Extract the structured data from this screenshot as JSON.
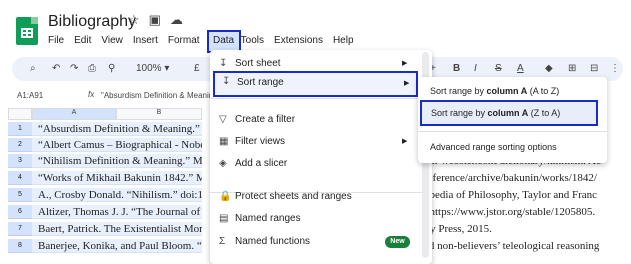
{
  "app": {
    "title": "Bibliography"
  },
  "menubar": [
    "File",
    "Edit",
    "View",
    "Insert",
    "Format",
    "Data",
    "Tools",
    "Extensions",
    "Help"
  ],
  "toolbar": {
    "zoom": "100%",
    "zoom_caret": "▾",
    "font_size_partial": "£",
    "bold": "B",
    "italic": "I",
    "strike": "S",
    "text_color": "A"
  },
  "formula_bar": {
    "cell_ref": "A1:A91",
    "fx": "fx",
    "content": "\"Absurdism Definition & Meaning.\" M"
  },
  "columns": [
    "A",
    "B"
  ],
  "rows": [
    {
      "num": "1",
      "a": "“Absurdism Definition & Meaning.” M",
      "right": ""
    },
    {
      "num": "2",
      "a": "“Albert Camus – Biographical - Nobel",
      "right": "am-webster.com/dictionary/nihilism. Ac"
    },
    {
      "num": "3",
      "a": "“Nihilism Definition & Meaning.” Me",
      "right": "reference/archive/bakunin/works/1842/"
    },
    {
      "num": "4",
      "a": "“Works of Mikhail Bakunin 1842.” Ma",
      "right": "opedia of Philosophy, Taylor and Franc"
    },
    {
      "num": "5",
      "a": "A., Crosby Donald. “Nihilism.” doi:10",
      "right": ", https://www.jstor.org/stable/1205805."
    },
    {
      "num": "6",
      "a": "Altizer, Thomas J. J. “The Journal of R",
      "right": "ity Press, 2015."
    },
    {
      "num": "7",
      "a": "Baert, Patrick. The Existentialist Mom",
      "right": ""
    },
    {
      "num": "8",
      "a": "Banerjee, Konika, and Paul Bloom. “W",
      "right": "ad non-believers’ teleological reasoning"
    }
  ],
  "data_menu": {
    "items": [
      {
        "label": "Sort sheet",
        "icon": "sort-icon",
        "glyph": "↧",
        "has_submenu": true
      },
      {
        "label": "Sort range",
        "icon": "sort-icon",
        "glyph": "↧",
        "has_submenu": true
      },
      {
        "label": "Create a filter",
        "icon": "filter-icon",
        "glyph": "▽",
        "has_submenu": false
      },
      {
        "label": "Filter views",
        "icon": "filter-views-icon",
        "glyph": "▦",
        "has_submenu": true
      },
      {
        "label": "Add a slicer",
        "icon": "slicer-icon",
        "glyph": "◈",
        "has_submenu": false
      },
      {
        "label": "Protect sheets and ranges",
        "icon": "lock-icon",
        "glyph": "🔒",
        "has_submenu": false
      },
      {
        "label": "Named ranges",
        "icon": "named-ranges-icon",
        "glyph": "▤",
        "has_submenu": false
      },
      {
        "label": "Named functions",
        "icon": "sigma-icon",
        "glyph": "Σ",
        "has_submenu": false,
        "badge": "New"
      }
    ],
    "arrow": "▶"
  },
  "sort_submenu": {
    "asc_prefix": "Sort range by ",
    "asc_bold": "column A",
    "asc_suffix": " (A to Z)",
    "desc_prefix": "Sort range by ",
    "desc_bold": "column A",
    "desc_suffix": " (Z to A)",
    "advanced": "Advanced range sorting options"
  },
  "colors": {
    "highlight_border": "#1a2cc8",
    "selection": "#d3e3fd",
    "sheets_green": "#0f9d58"
  }
}
